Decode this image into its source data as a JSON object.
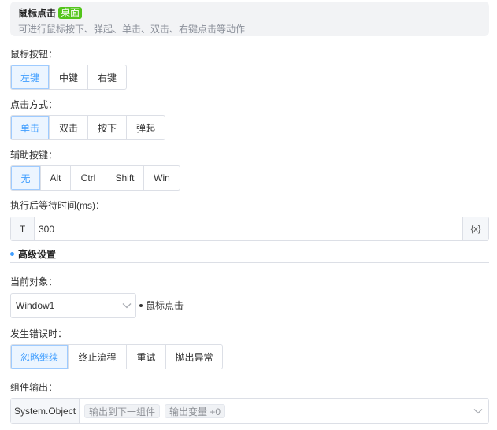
{
  "header": {
    "title": "鼠标点击",
    "tag": "桌面",
    "description": "可进行鼠标按下、弹起、单击、双击、右键点击等动作"
  },
  "mouse_button": {
    "label": "鼠标按钮：",
    "options": [
      "左键",
      "中键",
      "右键"
    ],
    "selected": "左键"
  },
  "click_mode": {
    "label": "点击方式：",
    "options": [
      "单击",
      "双击",
      "按下",
      "弹起"
    ],
    "selected": "单击"
  },
  "modifier_key": {
    "label": "辅助按键：",
    "options": [
      "无",
      "Alt",
      "Ctrl",
      "Shift",
      "Win"
    ],
    "selected": "无"
  },
  "wait_after": {
    "label": "执行后等待时间(ms)：",
    "prefix": "T",
    "value": "300",
    "suffix": "{x}"
  },
  "advanced": {
    "title": "高级设置"
  },
  "current_target": {
    "label": "当前对象：",
    "value": "Window1",
    "note": "鼠标点击"
  },
  "on_error": {
    "label": "发生错误时：",
    "options": [
      "忽略继续",
      "终止流程",
      "重试",
      "抛出异常"
    ],
    "selected": "忽略继续"
  },
  "component_output": {
    "label": "组件输出：",
    "type": "System.Object",
    "chips": [
      "输出到下一组件",
      "输出变量 +0"
    ]
  },
  "colors": {
    "accent": "#409eff",
    "tag_green": "#52c41a",
    "border": "#dcdfe6"
  }
}
